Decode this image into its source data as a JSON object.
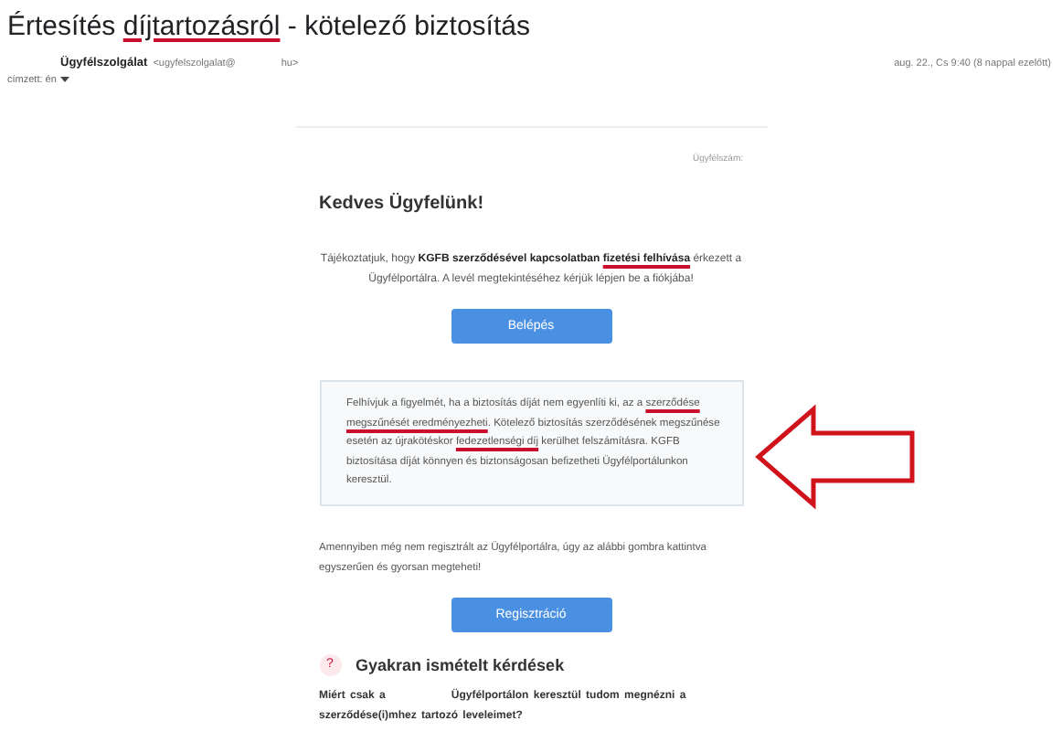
{
  "subject": [
    {
      "text": "Értesítés ",
      "underlined": false
    },
    {
      "text": "díjtartozásról",
      "underlined": true
    },
    {
      "text": " - kötelező biztosítás",
      "underlined": false
    }
  ],
  "sender": {
    "name": "Ügyfélszolgálat",
    "address": "<ugyfelszolgalat@",
    "domain": "hu>",
    "date": "aug. 22., Cs 9:40 (8 nappal ezelőtt)",
    "recipient": "címzett: én"
  },
  "email": {
    "customer_id_label": "Ügyfélszám:",
    "greeting": "Kedves Ügyfelünk!",
    "intro": [
      {
        "text": "Tájékoztatjuk, hogy ",
        "bold": false,
        "underlined": false
      },
      {
        "text": "KGFB szerződésével kapcsolatban ",
        "bold": true,
        "underlined": false
      },
      {
        "text": "fizetési felhívása",
        "bold": true,
        "underlined": true
      },
      {
        "text": " érkezett a Ügyfélportálra. A levél megtekintéséhez kérjük lépjen be a fiókjába!",
        "bold": false,
        "underlined": false
      }
    ],
    "login_button": "Belépés",
    "notice": [
      {
        "text": "Felhívjuk a figyelmét, ha a biztosítás díját nem egyenlíti ki, az a ",
        "underlined": false
      },
      {
        "text": "szerződése megszűnését eredményezheti",
        "underlined": true
      },
      {
        "text": ". Kötelező biztosítás szerződésének megszűnése esetén az újrakötéskor ",
        "underlined": false
      },
      {
        "text": "fedezetlenségi díj",
        "underlined": true
      },
      {
        "text": " kerülhet felszámításra. KGFB biztosítása díját könnyen és biztonságosan befizetheti Ügyfélportálunkon keresztül.",
        "underlined": false
      }
    ],
    "register_text": "Amennyiben még nem regisztrált az Ügyfélportálra, úgy az alábbi gombra kattintva egyszerűen és gyorsan megteheti!",
    "register_button": "Regisztráció",
    "faq_icon": "?",
    "faq_title": "Gyakran ismételt kérdések",
    "faq_question": [
      {
        "text": "Miért csak a"
      },
      {
        "text": "Ügyfélportálon keresztül tudom megnézni a szerződése(i)mhez tartozó leveleimet?"
      }
    ]
  }
}
